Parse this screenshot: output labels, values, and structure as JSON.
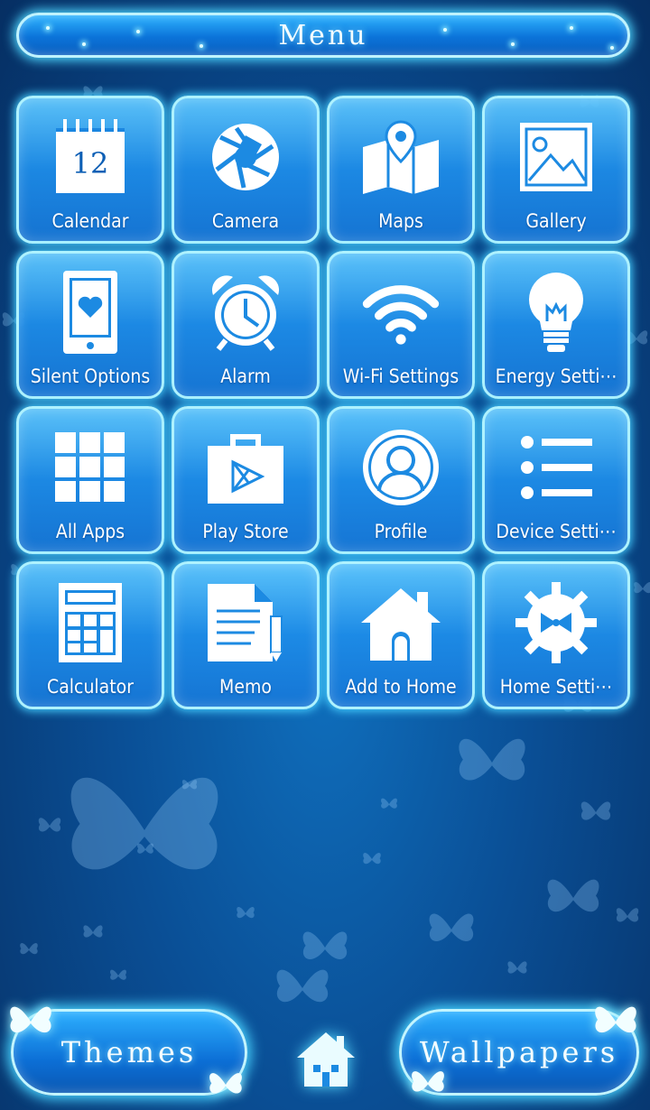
{
  "header": {
    "title": "Menu"
  },
  "tiles": [
    {
      "label": "Calendar",
      "icon": "calendar-icon",
      "day": "12"
    },
    {
      "label": "Camera",
      "icon": "camera-shutter-icon"
    },
    {
      "label": "Maps",
      "icon": "map-pin-icon"
    },
    {
      "label": "Gallery",
      "icon": "image-icon"
    },
    {
      "label": "Silent Options",
      "icon": "phone-heart-icon"
    },
    {
      "label": "Alarm",
      "icon": "alarm-clock-icon"
    },
    {
      "label": "Wi-Fi Settings",
      "icon": "wifi-icon"
    },
    {
      "label": "Energy Setti⋯",
      "icon": "lightbulb-icon"
    },
    {
      "label": "All Apps",
      "icon": "grid-icon"
    },
    {
      "label": "Play Store",
      "icon": "play-store-bag-icon"
    },
    {
      "label": "Profile",
      "icon": "person-icon"
    },
    {
      "label": "Device Setti⋯",
      "icon": "list-icon"
    },
    {
      "label": "Calculator",
      "icon": "calculator-icon"
    },
    {
      "label": "Memo",
      "icon": "memo-pencil-icon"
    },
    {
      "label": "Add to Home",
      "icon": "house-icon"
    },
    {
      "label": "Home Setti⋯",
      "icon": "gear-bowtie-icon"
    }
  ],
  "bottom": {
    "themes_label": "Themes",
    "wallpapers_label": "Wallpapers",
    "home_icon": "home-icon"
  },
  "colors": {
    "accent_glow": "#4fd7ff",
    "tile_border": "#aef2ff",
    "background_dark": "#062f63"
  }
}
